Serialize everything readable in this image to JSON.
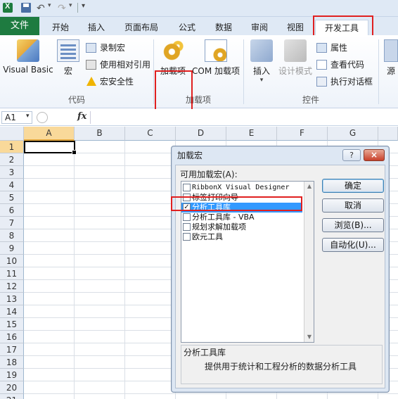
{
  "qat": {
    "more_glyph": "▾"
  },
  "tabs": {
    "file": "文件",
    "items": [
      "开始",
      "插入",
      "页面布局",
      "公式",
      "数据",
      "审阅",
      "视图",
      "开发工具"
    ]
  },
  "ribbon": {
    "code_group": {
      "label": "代码",
      "visual_basic": "Visual Basic",
      "macros": "宏",
      "record_macro": "录制宏",
      "relative_refs": "使用相对引用",
      "macro_security": "宏安全性"
    },
    "addins_group": {
      "label": "加载项",
      "addins": "加载项",
      "com_addins": "COM 加载项"
    },
    "controls_group": {
      "label": "控件",
      "insert": "插入",
      "insert_caret": "▾",
      "design_mode": "设计模式",
      "properties": "属性",
      "view_code": "查看代码",
      "run_dialog": "执行对话框"
    },
    "source_partial": "源"
  },
  "formula_bar": {
    "name_box": "A1",
    "fx": "fx",
    "value": ""
  },
  "grid": {
    "columns": [
      "A",
      "B",
      "C",
      "D",
      "E",
      "F",
      "G"
    ],
    "rows": [
      "1",
      "2",
      "3",
      "4",
      "5",
      "6",
      "7",
      "8",
      "9",
      "10",
      "11",
      "12",
      "13",
      "14",
      "15",
      "16",
      "17",
      "18",
      "19",
      "20",
      "21"
    ],
    "active_cell": "A1"
  },
  "dialog": {
    "title": "加载宏",
    "help": "?",
    "close": "×",
    "list_label": "可用加载宏(A):",
    "addins": [
      {
        "label": "RibbonX Visual Designer",
        "checked": false,
        "selected": false,
        "mono": true
      },
      {
        "label": "标签打印向导",
        "checked": false,
        "selected": false,
        "mono": false
      },
      {
        "label": "分析工具库",
        "checked": true,
        "selected": true,
        "mono": false
      },
      {
        "label": "分析工具库 - VBA",
        "checked": false,
        "selected": false,
        "mono": false
      },
      {
        "label": "规划求解加载项",
        "checked": false,
        "selected": false,
        "mono": false
      },
      {
        "label": "欧元工具",
        "checked": false,
        "selected": false,
        "mono": false
      }
    ],
    "buttons": {
      "ok": "确定",
      "cancel": "取消",
      "browse": "浏览(B)...",
      "automation": "自动化(U)..."
    },
    "description": {
      "title": "分析工具库",
      "text": "提供用于统计和工程分析的数据分析工具"
    }
  },
  "colors": {
    "file_tab": "#1e7b40",
    "highlight": "#e02020",
    "selection": "#3399ff",
    "active_header": "#f9d99a"
  }
}
